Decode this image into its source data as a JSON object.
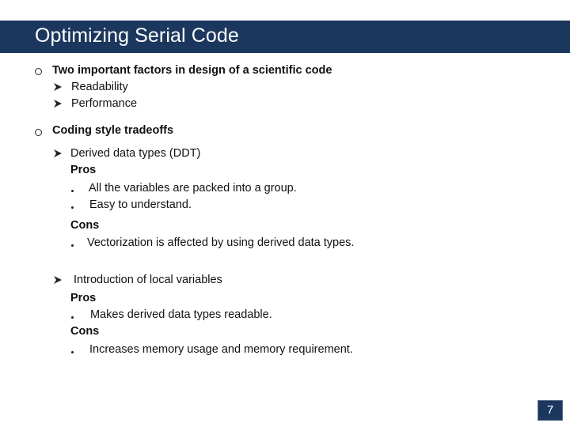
{
  "slide": {
    "title": "Optimizing Serial Code",
    "page_number": "7",
    "colors": {
      "title_bar": "#1b375d",
      "title_text": "#ffffff"
    }
  },
  "content": {
    "section1": {
      "heading": "Two important factors in design of a scientific code",
      "items": [
        "Readability",
        "Performance"
      ]
    },
    "section2": {
      "heading": "Coding style tradeoffs",
      "topics": [
        {
          "label": "Derived data types (DDT)",
          "pros_label": "Pros",
          "pros": [
            "All the variables are packed into a group.",
            "Easy to understand."
          ],
          "cons_label": "Cons",
          "cons": [
            "Vectorization is affected by using derived data types."
          ]
        },
        {
          "label": "Introduction of local variables",
          "pros_label": "Pros",
          "pros": [
            "Makes derived data types readable."
          ],
          "cons_label": "Cons",
          "cons": [
            "Increases memory usage and memory requirement."
          ]
        }
      ]
    }
  }
}
